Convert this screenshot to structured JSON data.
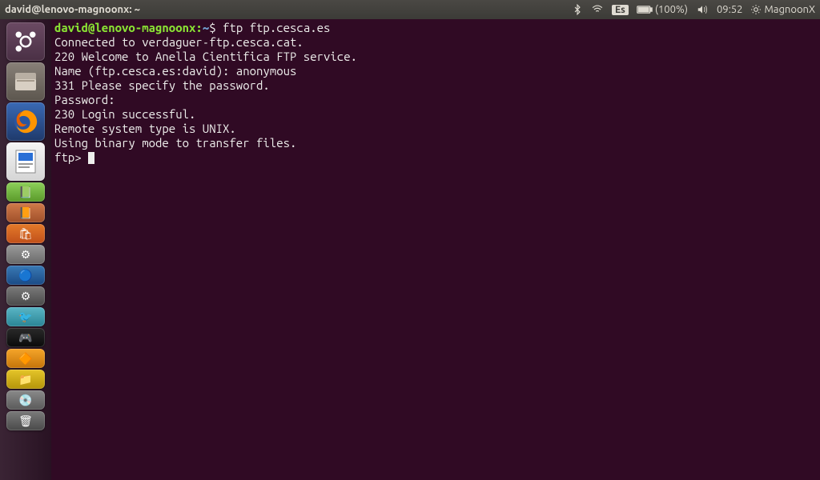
{
  "menubar": {
    "title": "david@lenovo-magnoonx: ~",
    "language": "Es",
    "battery": "(100%)",
    "time": "09:52",
    "user": "MagnoonX"
  },
  "terminal": {
    "prompt_userhost": "david@lenovo-magnoonx",
    "prompt_path": "~",
    "command": "ftp ftp.cesca.es",
    "lines": [
      "Connected to verdaguer-ftp.cesca.cat.",
      "220 Welcome to Anella Cientifica FTP service.",
      "Name (ftp.cesca.es:david): anonymous",
      "331 Please specify the password.",
      "Password:",
      "230 Login successful.",
      "Remote system type is UNIX.",
      "Using binary mode to transfer files."
    ],
    "final_prompt": "ftp> "
  }
}
